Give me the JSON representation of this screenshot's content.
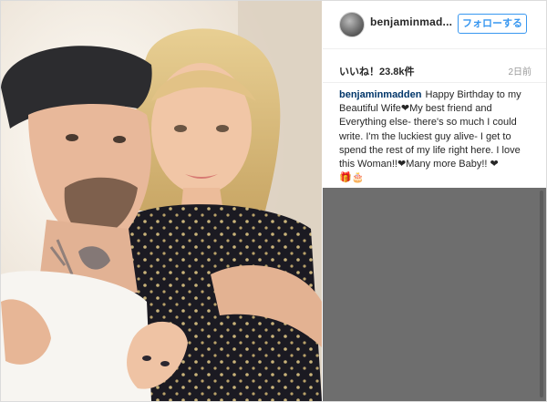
{
  "post": {
    "username": "benjaminmad...",
    "follow_label": "フォローする",
    "likes": "いいね！23.8k件",
    "time_ago": "2日前",
    "caption_user": "benjaminmadden",
    "caption_text": "Happy Birthday to my Beautiful Wife❤My best friend and Everything else- there's so much I could write. I'm the luckiest guy alive- I get to spend the rest of my life right here. I love this Woman!!❤Many more Baby!! ❤",
    "caption_emoji": "🎁🎂"
  },
  "icons": {
    "avatar": "profile-avatar",
    "photo": "couple-selfie-photo"
  },
  "colors": {
    "accent": "#3897f0",
    "username_link": "#003569",
    "comments_overlay": "#6e6e6e",
    "border": "#dbdbdb"
  }
}
